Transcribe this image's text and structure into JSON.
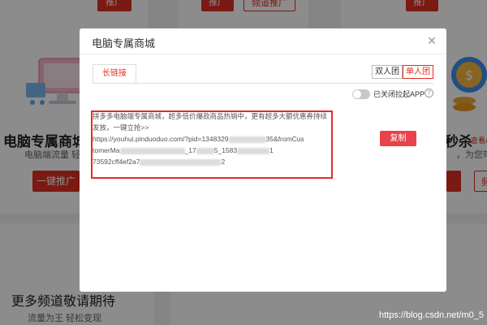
{
  "background": {
    "card_a": {
      "top_button": "推广",
      "title": "电脑专属商城",
      "subtitle": "电脑端流量 轻松",
      "button": "一键推广"
    },
    "card_b": {
      "top_button_red": "推广",
      "top_button_outline": "频道推广"
    },
    "card_c": {
      "top_button": "推广",
      "title": "秒杀",
      "subtitle": "，为您带",
      "tag": "查看A",
      "button_outline": "频"
    },
    "card_d": {
      "title": "更多频道敬请期待",
      "subtitle": "流量为王 轻松变现"
    }
  },
  "modal": {
    "title": "电脑专属商城",
    "tab_link": "长链接",
    "segments": [
      "双人团",
      "单人团"
    ],
    "toggle_label": "已关闭拉起APP",
    "help": "?",
    "link_line_1": "拼多多电脑端专属商城，超多低价爆款商品热销中，更有超多大额优惠券持续发放，一键立抢>>",
    "url_part_1": "https://youhui.pinduoduo.com/?pid=1348329",
    "url_part_2": "35&fromCus",
    "url_part_3": "tomerMa",
    "url_part_4": "_17",
    "url_part_5": "5_1583",
    "url_part_6": "1",
    "url_part_7": "73592cff4ef2a7",
    "url_part_8": "2",
    "copy_button": "复制"
  },
  "watermark": "https://blog.csdn.net/m0_5",
  "colors": {
    "brand_red": "#e02e24",
    "copy_red": "#e8434c"
  }
}
